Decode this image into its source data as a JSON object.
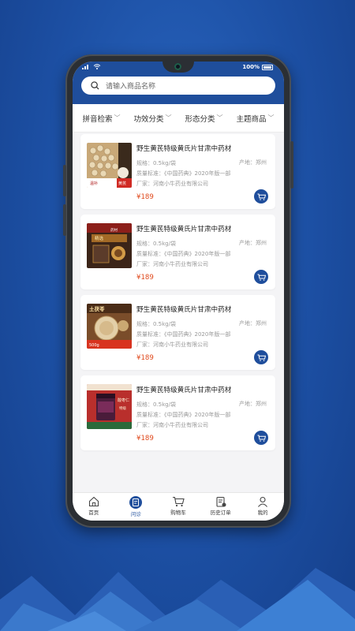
{
  "status_bar": {
    "battery": "100%"
  },
  "search": {
    "placeholder": "请输入商品名称"
  },
  "filters": [
    {
      "label": "拼音检索"
    },
    {
      "label": "功效分类"
    },
    {
      "label": "形态分类"
    },
    {
      "label": "主题商品"
    }
  ],
  "products": [
    {
      "title": "野生黄芪特级黄氏片甘肃中药材",
      "spec": "规格：0.5kg/袋",
      "origin": "产地：郑州",
      "standard": "质量标准：《中国药典》2020年版一部",
      "maker": "厂家：河南小牛药业有限公司",
      "price": "¥189",
      "thumb_text": [
        "温补",
        "黄芪"
      ],
      "thumb_icon": "product-photo-1-icon"
    },
    {
      "title": "野生黄芪特级黄氏片甘肃中药材",
      "spec": "规格：0.5kg/袋",
      "origin": "产地：郑州",
      "standard": "质量标准：《中国药典》2020年版一部",
      "maker": "厂家：河南小牛药业有限公司",
      "price": "¥189",
      "thumb_text": [
        "精选",
        "药材"
      ],
      "thumb_icon": "product-photo-2-icon"
    },
    {
      "title": "野生黄芪特级黄氏片甘肃中药材",
      "spec": "规格：0.5kg/袋",
      "origin": "产地：郑州",
      "standard": "质量标准：《中国药典》2020年版一部",
      "maker": "厂家：河南小牛药业有限公司",
      "price": "¥189",
      "thumb_text": [
        "土茯苓",
        "500g"
      ],
      "thumb_icon": "product-photo-3-icon"
    },
    {
      "title": "野生黄芪特级黄氏片甘肃中药材",
      "spec": "规格：0.5kg/袋",
      "origin": "产地：郑州",
      "standard": "质量标准：《中国药典》2020年版一部",
      "maker": "厂家：河南小牛药业有限公司",
      "price": "¥189",
      "thumb_text": [
        "酸枣仁",
        "特级"
      ],
      "thumb_icon": "product-photo-4-icon"
    }
  ],
  "tabbar": [
    {
      "label": "首页",
      "icon": "home-icon",
      "active": false
    },
    {
      "label": "问诊",
      "icon": "consult-icon",
      "active": true
    },
    {
      "label": "购物车",
      "icon": "cart-icon",
      "active": false
    },
    {
      "label": "历史订单",
      "icon": "order-history-icon",
      "active": false
    },
    {
      "label": "我的",
      "icon": "profile-icon",
      "active": false
    }
  ],
  "colors": {
    "primary": "#1f4e9c",
    "price": "#e04a1d",
    "background": "#1c4fa3"
  }
}
